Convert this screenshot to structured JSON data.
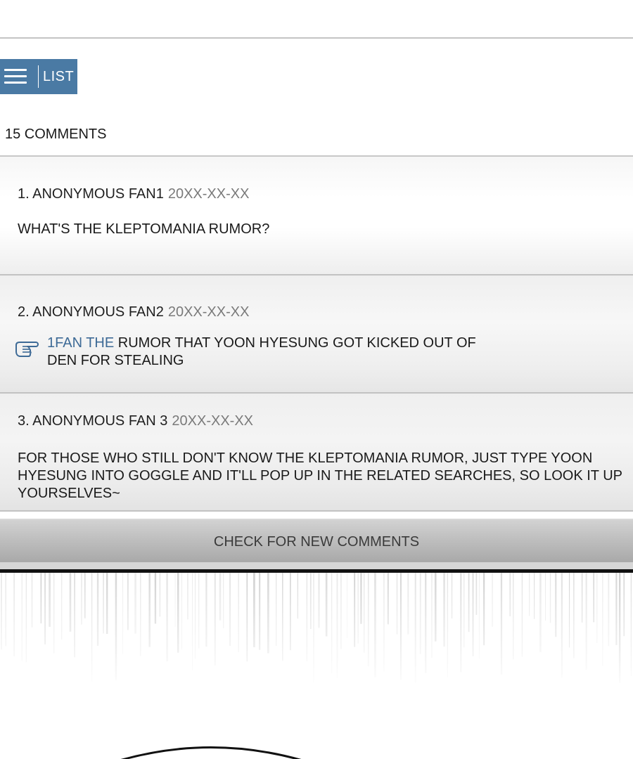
{
  "list_button": {
    "label": "LIST",
    "icon": "hamburger-icon",
    "color": "#4a7aa4"
  },
  "comments_header": {
    "count_label": "15 COMMENTS"
  },
  "comments": [
    {
      "author": "1. ANONYMOUS FAN1",
      "date": "20XX-XX-XX",
      "text": "WHAT'S THE KLEPTOMANIA RUMOR?"
    },
    {
      "author": "2. ANONYMOUS FAN2",
      "date": "20XX-XX-XX",
      "reply_icon": "pointing-hand-icon",
      "reply_tag": "1FAN THE",
      "text": "RUMOR THAT YOON HYESUNG GOT KICKED OUT OF DEN FOR STEALING"
    },
    {
      "author": "3. ANONYMOUS FAN 3",
      "date": "20XX-XX-XX",
      "text": "FOR THOSE WHO STILL DON'T KNOW THE KLEPTOMANIA RUMOR, JUST TYPE YOON HYESUNG INTO GOGGLE AND IT'LL POP UP IN THE RELATED SEARCHES, SO LOOK IT UP YOURSELVES~"
    }
  ],
  "check_button": {
    "label": "CHECK FOR NEW COMMENTS"
  },
  "colors": {
    "reply_tag": "#3d6a96",
    "date": "#7a7a7a"
  }
}
